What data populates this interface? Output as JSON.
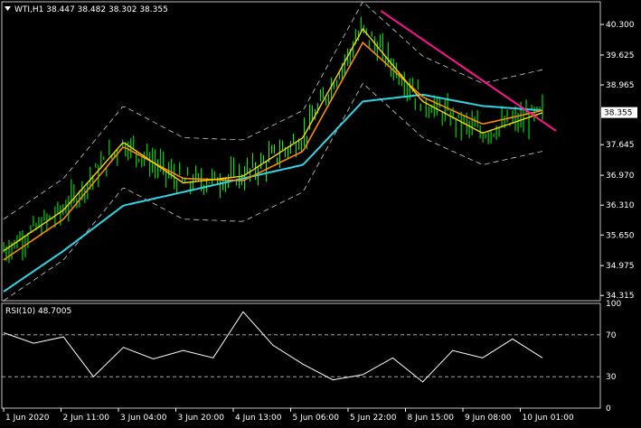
{
  "header": {
    "symbol_title": "WTI,H1",
    "ohlc": "38.447 38.482 38.302 38.355"
  },
  "rsi_panel": {
    "label": "RSI(10) 48.7005",
    "levels": [
      "100",
      "70",
      "30",
      "0"
    ]
  },
  "price_axis": {
    "ticks": [
      "40.300",
      "39.625",
      "38.965",
      "37.645",
      "36.970",
      "36.310",
      "35.650",
      "34.975",
      "34.315"
    ],
    "current_price": "38.355"
  },
  "time_axis": {
    "ticks": [
      "1 Jun 2020",
      "2 Jun 11:00",
      "3 Jun 04:00",
      "3 Jun 20:00",
      "4 Jun 13:00",
      "5 Jun 06:00",
      "5 Jun 22:00",
      "8 Jun 15:00",
      "9 Jun 08:00",
      "10 Jun 01:00"
    ]
  },
  "colors": {
    "background": "#000000",
    "axis": "#ffffff",
    "candles": "#00ff00",
    "ma_fast": "#ffd700",
    "ma_mid": "#ff8c00",
    "ma_slow": "#32d4e6",
    "bollinger": "#ffffff",
    "trendline": "#ff1493",
    "rsi": "#ffffff"
  },
  "chart_data": {
    "type": "line",
    "title": "WTI,H1",
    "x": [
      "1 Jun 2020",
      "2 Jun 11:00",
      "3 Jun 04:00",
      "3 Jun 20:00",
      "4 Jun 13:00",
      "5 Jun 06:00",
      "5 Jun 22:00",
      "8 Jun 15:00",
      "9 Jun 08:00",
      "10 Jun 01:00"
    ],
    "ylim": [
      34.2,
      40.8
    ],
    "series": [
      {
        "values": [
          35.3,
          36.2,
          37.7,
          36.8,
          36.95,
          37.8,
          40.2,
          38.6,
          37.9,
          38.35
        ]
      },
      {
        "values": [
          35.1,
          36.0,
          37.6,
          36.9,
          36.85,
          37.5,
          39.9,
          38.7,
          38.1,
          38.4
        ]
      },
      {
        "values": [
          34.4,
          35.3,
          36.3,
          36.6,
          36.9,
          37.2,
          38.6,
          38.75,
          38.5,
          38.4
        ]
      }
    ],
    "rsi": {
      "ylim": [
        0,
        100
      ],
      "levels": [
        70,
        30
      ],
      "values": [
        72,
        62,
        68,
        30,
        58,
        47,
        55,
        48,
        92,
        60,
        42,
        27,
        32,
        48,
        25,
        55,
        48,
        66,
        48
      ]
    },
    "trendline": {
      "from": [
        "5 Jun 22:00",
        40.6
      ],
      "to": [
        "10 Jun 01:00",
        37.95
      ]
    }
  }
}
